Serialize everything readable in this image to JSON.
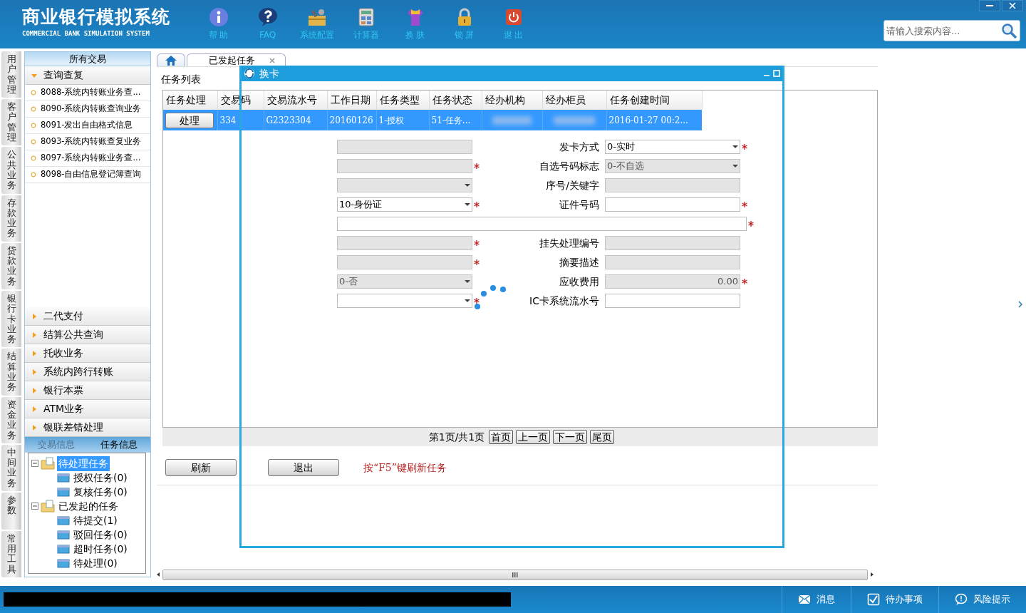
{
  "header": {
    "title": "商业银行模拟系统",
    "subtitle": "COMMERCIAL BANK SIMULATION SYSTEM",
    "tools": [
      {
        "kind": "info",
        "label": "帮 助"
      },
      {
        "kind": "faq",
        "label": "FAQ"
      },
      {
        "kind": "config",
        "label": "系统配置"
      },
      {
        "kind": "calc",
        "label": "计算器"
      },
      {
        "kind": "skin",
        "label": "换 肤"
      },
      {
        "kind": "lock",
        "label": "锁 屏"
      },
      {
        "kind": "exit",
        "label": "退 出"
      }
    ],
    "search": {
      "placeholder": "请输入搜索内容..."
    }
  },
  "left_tabs": [
    {
      "label": "用户管理"
    },
    {
      "label": "客户管理"
    },
    {
      "label": "公共业务"
    },
    {
      "label": "存款业务"
    },
    {
      "label": "贷款业务"
    },
    {
      "label": "银行卡业务"
    },
    {
      "label": "结算业务"
    },
    {
      "label": "资金业务"
    },
    {
      "label": "中间业务"
    },
    {
      "label": "参数"
    },
    {
      "label": "常用工具"
    }
  ],
  "sidebar": {
    "title": "所有交易",
    "groups": [
      {
        "label": "查询查复",
        "expanded": true,
        "items": [
          "8088-系统内转账业务查...",
          "8090-系统内转账查询业务",
          "8091-发出自由格式信息",
          "8093-系统内转账查复业务",
          "8097-系统内转账业务查...",
          "8098-自由信息登记簿查询"
        ]
      },
      {
        "label": "二代支付",
        "expanded": false
      },
      {
        "label": "结算公共查询",
        "expanded": false
      },
      {
        "label": "托收业务",
        "expanded": false
      },
      {
        "label": "系统内跨行转账",
        "expanded": false
      },
      {
        "label": "银行本票",
        "expanded": false
      },
      {
        "label": "ATM业务",
        "expanded": false
      },
      {
        "label": "银联差错处理",
        "expanded": false
      }
    ],
    "info_tabs": [
      {
        "label": "交易信息",
        "selected": false
      },
      {
        "label": "任务信息",
        "selected": true
      }
    ],
    "tree": [
      {
        "label": "待处理任务",
        "selected": true,
        "expanded": true,
        "children": [
          {
            "label": "授权任务(0)",
            "selected": false
          },
          {
            "label": "复核任务(0)",
            "selected": false
          }
        ]
      },
      {
        "label": "已发起的任务",
        "selected": false,
        "expanded": true,
        "children": [
          {
            "label": "待提交(1)",
            "selected": false
          },
          {
            "label": "驳回任务(0)",
            "selected": false
          },
          {
            "label": "超时任务(0)",
            "selected": false
          },
          {
            "label": "待处理(0)",
            "selected": false
          }
        ]
      }
    ]
  },
  "tabs": [
    {
      "kind": "home",
      "selected": false
    },
    {
      "kind": "text",
      "label": "已发起任务",
      "selected": true
    }
  ],
  "task_list": {
    "title": "任务列表",
    "columns": [
      "任务处理",
      "交易码",
      "交易流水号",
      "工作日期",
      "任务类型",
      "任务状态",
      "经办机构",
      "经办柜员",
      "任务创建时间"
    ],
    "rows": [
      {
        "selected": true,
        "cells": [
          {
            "kind": "button",
            "text": "处理"
          },
          {
            "text": "334"
          },
          {
            "text": "G2323304"
          },
          {
            "text": "20160126"
          },
          {
            "text": "1-授权"
          },
          {
            "text": "51-任务..."
          },
          {
            "kind": "redacted"
          },
          {
            "kind": "redacted"
          },
          {
            "text": "2016-01-27 00:2..."
          }
        ]
      }
    ],
    "pagination": {
      "info": "第1页/共1页",
      "buttons": [
        "首页",
        "上一页",
        "下一页",
        "尾页"
      ]
    },
    "buttons": [
      "刷新",
      "退出"
    ],
    "hint": "按“F5”键刷新任务"
  },
  "dialog": {
    "title": "换卡",
    "loading": true,
    "rows": [
      {
        "left": {
          "kind": "input",
          "disabled": true,
          "required": false
        },
        "right": {
          "label": "发卡方式",
          "kind": "select",
          "value": "0-实时",
          "disabled": false,
          "required": true
        }
      },
      {
        "left": {
          "kind": "input",
          "disabled": true,
          "required": true
        },
        "right": {
          "label": "自选号码标志",
          "kind": "select",
          "value": "0-不自选",
          "disabled": true,
          "required": false
        }
      },
      {
        "left": {
          "kind": "select",
          "disabled": true,
          "required": false
        },
        "right": {
          "label": "序号/关键字",
          "kind": "input",
          "disabled": true,
          "required": false
        }
      },
      {
        "left": {
          "kind": "select",
          "value": "10-身份证",
          "disabled": false,
          "required": true
        },
        "right": {
          "label": "证件号码",
          "kind": "input",
          "disabled": false,
          "required": true
        }
      },
      {
        "full": {
          "kind": "input",
          "disabled": false,
          "required": true
        }
      },
      {
        "left": {
          "kind": "input",
          "disabled": true,
          "required": true
        },
        "right": {
          "label": "挂失处理编号",
          "kind": "input",
          "disabled": true,
          "required": false
        }
      },
      {
        "left": {
          "kind": "input",
          "disabled": true,
          "required": true
        },
        "right": {
          "label": "摘要描述",
          "kind": "input",
          "disabled": true,
          "required": false
        }
      },
      {
        "left": {
          "kind": "select",
          "value": "0-否",
          "disabled": true,
          "required": false
        },
        "right": {
          "label": "应收费用",
          "kind": "input",
          "value": "0.00",
          "disabled": true,
          "required": true
        }
      },
      {
        "left": {
          "kind": "select",
          "disabled": false,
          "required": true
        },
        "right": {
          "label": "IC卡系统流水号",
          "kind": "input",
          "disabled": false,
          "required": false
        }
      }
    ]
  },
  "status_bar": {
    "redacted": true,
    "items": [
      {
        "kind": "message",
        "label": "消息"
      },
      {
        "kind": "todo",
        "label": "待办事项"
      },
      {
        "kind": "risk",
        "label": "风险提示"
      }
    ]
  }
}
